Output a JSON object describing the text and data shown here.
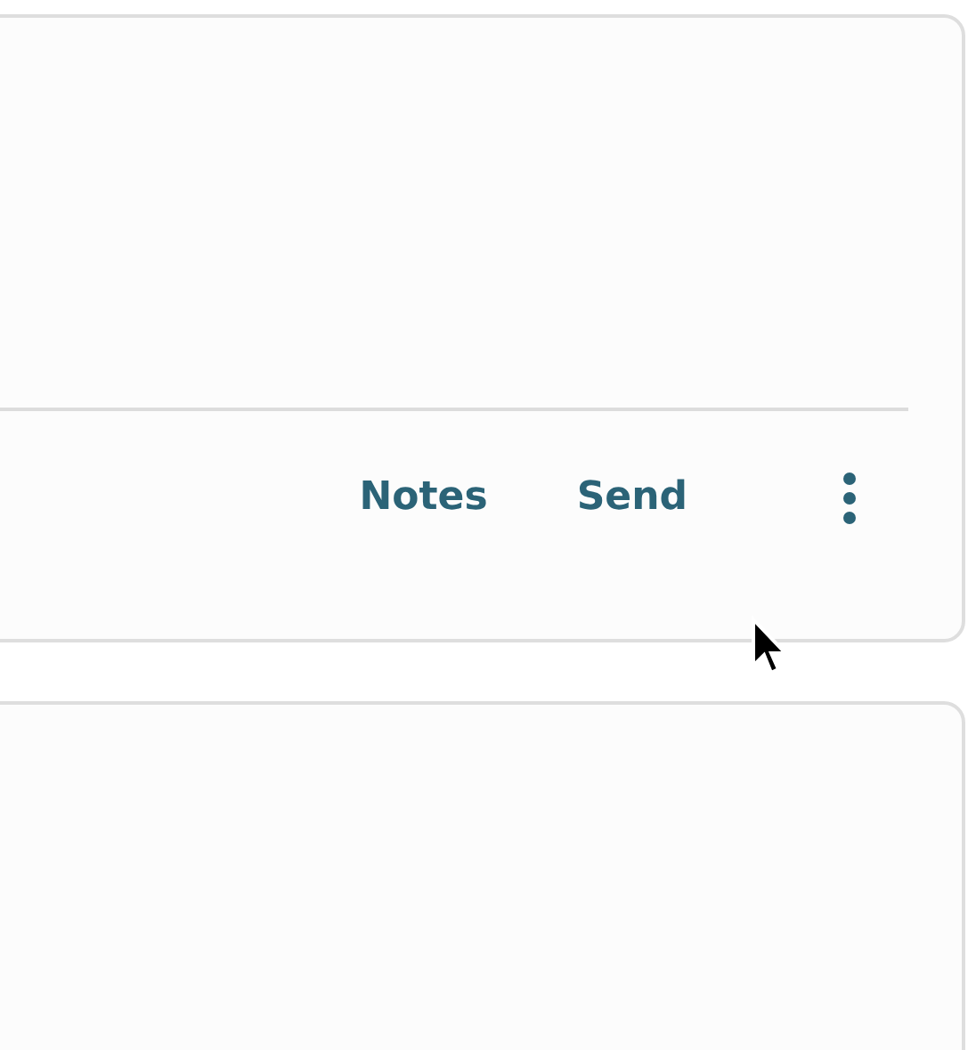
{
  "card": {
    "actions": [
      {
        "label": "Notes"
      },
      {
        "label": "Send"
      }
    ]
  }
}
